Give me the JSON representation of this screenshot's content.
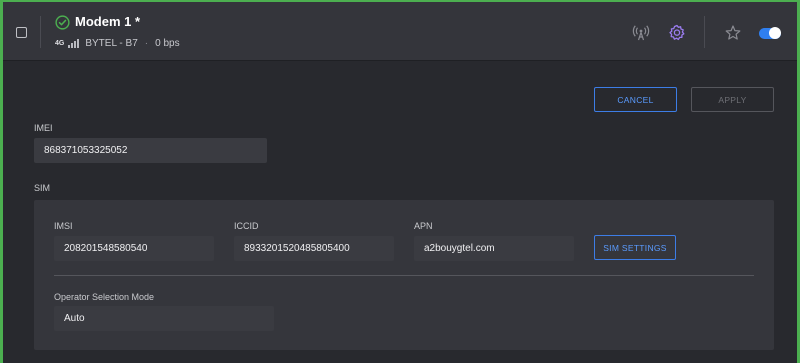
{
  "header": {
    "title": "Modem 1 *",
    "network_type": "4G",
    "operator": "BYTEL - B7",
    "speed": "0 bps",
    "status_icon": "check-circle-icon",
    "icons": [
      "antenna-icon",
      "gear-icon",
      "star-icon"
    ],
    "toggle_on": true
  },
  "actions": {
    "cancel_label": "CANCEL",
    "apply_label": "APPLY"
  },
  "imei": {
    "label": "IMEI",
    "value": "868371053325052"
  },
  "sim": {
    "section_label": "SIM",
    "imsi": {
      "label": "IMSI",
      "value": "208201548580540"
    },
    "iccid": {
      "label": "ICCID",
      "value": "8933201520485805400"
    },
    "apn": {
      "label": "APN",
      "value": "a2bouygtel.com"
    },
    "settings_label": "SIM SETTINGS",
    "operator_mode": {
      "label": "Operator Selection Mode",
      "value": "Auto"
    }
  },
  "colors": {
    "accent": "#2f7ff0",
    "active_border": "#4caf50",
    "gear": "#9b7df0"
  }
}
